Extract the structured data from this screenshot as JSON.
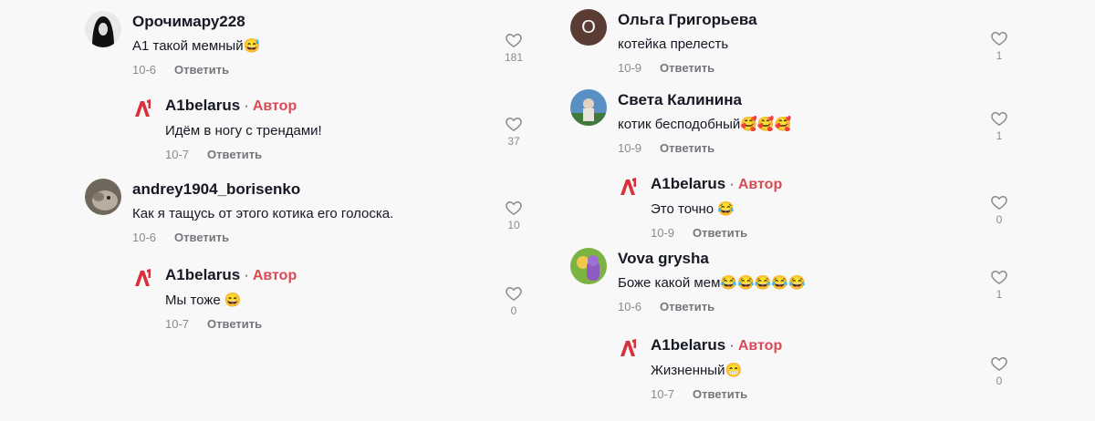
{
  "reply_label": "Ответить",
  "author_badge": "Автор",
  "left": [
    {
      "name": "Орочимару228",
      "text": "А1 такой мемный😅",
      "date": "10-6",
      "likes": "181",
      "avatar": "photo-dark"
    },
    {
      "name": "A1belarus",
      "text": "Идём в ногу с трендами!",
      "date": "10-7",
      "likes": "37",
      "avatar": "brand",
      "author": true,
      "reply": true
    },
    {
      "name": "andrey1904_borisenko",
      "text": "Как я тащусь от этого котика его голоска.",
      "date": "10-6",
      "likes": "10",
      "avatar": "photo-cat"
    },
    {
      "name": "A1belarus",
      "text": "Мы тоже 😄",
      "date": "10-7",
      "likes": "0",
      "avatar": "brand",
      "author": true,
      "reply": true
    }
  ],
  "right": [
    {
      "name": "Ольга Григорьева",
      "text": "котейка прелесть",
      "date": "10-9",
      "likes": "1",
      "avatar": "letter",
      "letter": "О",
      "color": "#5b3c34"
    },
    {
      "name": "Света Калинина",
      "text": "котик бесподобный🥰🥰🥰",
      "date": "10-9",
      "likes": "1",
      "avatar": "photo-outdoor"
    },
    {
      "name": "A1belarus",
      "text": "Это точно 😂",
      "date": "10-9",
      "likes": "0",
      "avatar": "brand",
      "author": true,
      "reply": true
    },
    {
      "name": "Vova grysha",
      "text": "Боже какой мем😂😂😂😂😂",
      "date": "10-6",
      "likes": "1",
      "avatar": "photo-purple"
    },
    {
      "name": "A1belarus",
      "text": "Жизненный😁",
      "date": "10-7",
      "likes": "0",
      "avatar": "brand",
      "author": true,
      "reply": true
    }
  ]
}
